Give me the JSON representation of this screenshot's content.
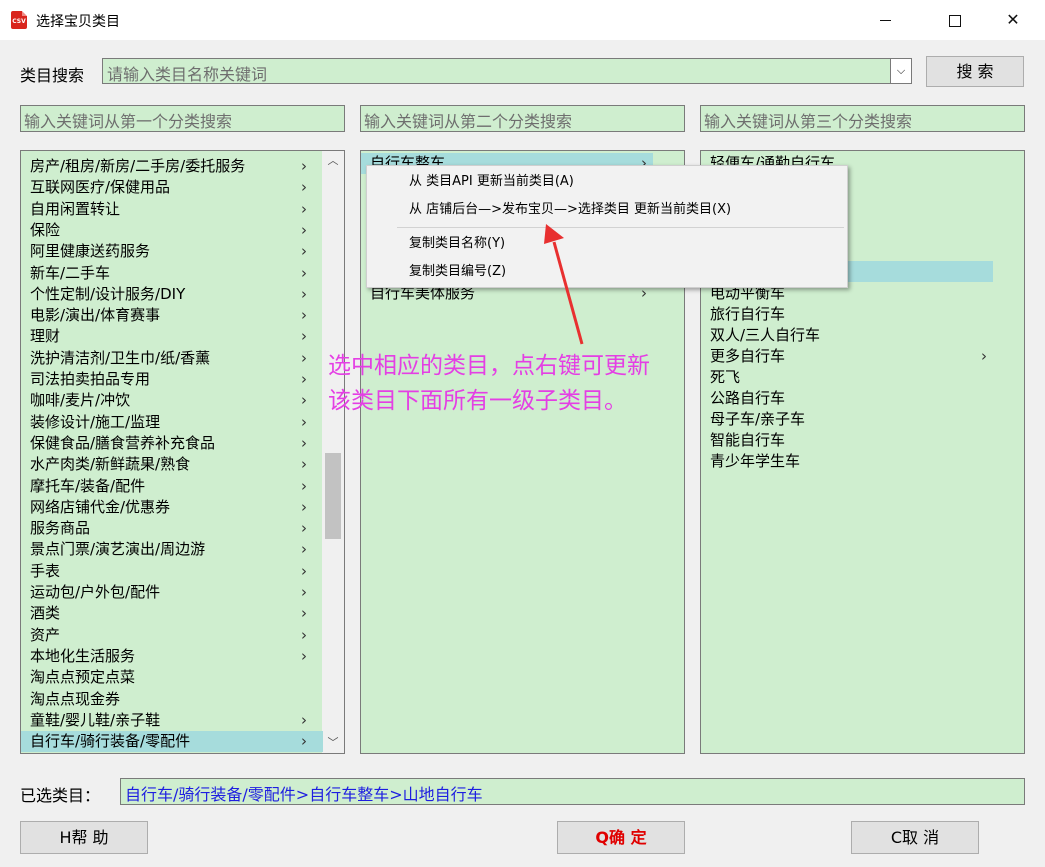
{
  "window": {
    "title": "选择宝贝类目",
    "app_icon_text": "CSV"
  },
  "search": {
    "label": "类目搜索",
    "placeholder": "请输入类目名称关键词",
    "button": "搜 索"
  },
  "filters": {
    "first": "输入关键词从第一个分类搜索",
    "second": "输入关键词从第二个分类搜索",
    "third": "输入关键词从第三个分类搜索"
  },
  "list1": {
    "items": [
      {
        "label": "房产/租房/新房/二手房/委托服务",
        "has_children": true
      },
      {
        "label": "互联网医疗/保健用品",
        "has_children": true
      },
      {
        "label": "自用闲置转让",
        "has_children": true
      },
      {
        "label": "保险",
        "has_children": true
      },
      {
        "label": "阿里健康送药服务",
        "has_children": true
      },
      {
        "label": "新车/二手车",
        "has_children": true
      },
      {
        "label": "个性定制/设计服务/DIY",
        "has_children": true
      },
      {
        "label": "电影/演出/体育赛事",
        "has_children": true
      },
      {
        "label": "理财",
        "has_children": true
      },
      {
        "label": "洗护清洁剂/卫生巾/纸/香薰",
        "has_children": true
      },
      {
        "label": "司法拍卖拍品专用",
        "has_children": true
      },
      {
        "label": "咖啡/麦片/冲饮",
        "has_children": true
      },
      {
        "label": "装修设计/施工/监理",
        "has_children": true
      },
      {
        "label": "保健食品/膳食营养补充食品",
        "has_children": true
      },
      {
        "label": "水产肉类/新鲜蔬果/熟食",
        "has_children": true
      },
      {
        "label": "摩托车/装备/配件",
        "has_children": true
      },
      {
        "label": "网络店铺代金/优惠券",
        "has_children": true
      },
      {
        "label": "服务商品",
        "has_children": true
      },
      {
        "label": "景点门票/演艺演出/周边游",
        "has_children": true
      },
      {
        "label": "手表",
        "has_children": true
      },
      {
        "label": "运动包/户外包/配件",
        "has_children": true
      },
      {
        "label": "酒类",
        "has_children": true
      },
      {
        "label": "资产",
        "has_children": true
      },
      {
        "label": "本地化生活服务",
        "has_children": true
      },
      {
        "label": "淘点点预定点菜",
        "has_children": false
      },
      {
        "label": "淘点点现金券",
        "has_children": false
      },
      {
        "label": "童鞋/婴儿鞋/亲子鞋",
        "has_children": true
      },
      {
        "label": "自行车/骑行装备/零配件",
        "has_children": true,
        "selected": true
      }
    ]
  },
  "list2": {
    "items": [
      {
        "label": "自行车整车",
        "has_children": true,
        "selected": true
      },
      {
        "label": "自行车美体服务",
        "has_children": true
      }
    ]
  },
  "list3": {
    "items": [
      {
        "label": "轻便车/通勤自行车",
        "has_children": false
      },
      {
        "label": "电动平衡车",
        "has_children": false
      },
      {
        "label": "旅行自行车",
        "has_children": false
      },
      {
        "label": "双人/三人自行车",
        "has_children": false
      },
      {
        "label": "更多自行车",
        "has_children": true
      },
      {
        "label": "死飞",
        "has_children": false
      },
      {
        "label": "公路自行车",
        "has_children": false
      },
      {
        "label": "母子车/亲子车",
        "has_children": false
      },
      {
        "label": "智能自行车",
        "has_children": false
      },
      {
        "label": "青少年学生车",
        "has_children": false
      }
    ]
  },
  "context_menu": {
    "items": [
      "从 类目API 更新当前类目(A)",
      "从 店铺后台—>发布宝贝—>选择类目 更新当前类目(X)",
      "复制类目名称(Y)",
      "复制类目编号(Z)"
    ]
  },
  "annotation": {
    "line1": "选中相应的类目，点右键可更新",
    "line2": "该类目下面所有一级子类目。"
  },
  "selected": {
    "label": "已选类目：",
    "value": "自行车/骑行装备/零配件>自行车整车>山地自行车"
  },
  "buttons": {
    "help": "H帮 助",
    "ok": "Q确 定",
    "cancel": "C取 消"
  },
  "colors": {
    "list_bg": "#cfeecf",
    "selected_bg": "#a6dcdc",
    "annotation": "#e43fe4",
    "ok_text": "#e00000",
    "selected_value": "#1e1ee0"
  }
}
